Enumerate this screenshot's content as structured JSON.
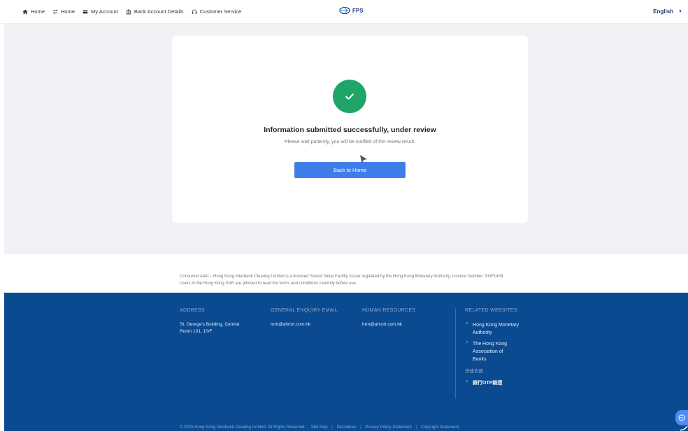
{
  "nav": {
    "items": [
      {
        "label": "Home",
        "icon": "home-icon"
      },
      {
        "label": "Home",
        "icon": "transfer-icon"
      },
      {
        "label": "My Account",
        "icon": "account-icon"
      },
      {
        "label": "Bank Account Details",
        "icon": "bank-icon"
      },
      {
        "label": "Customer Service",
        "icon": "support-icon"
      }
    ],
    "brand": "FPS",
    "language": "English"
  },
  "result": {
    "title": "Information submitted successfully, under review",
    "subtitle": "Please wait patiently, you will be notified of the review result.",
    "button": "Back to Home",
    "status_color": "#1fa568"
  },
  "alert": {
    "text": "Consumer Alert – Hong Kong Interbank Clearing Limited is a licensed Stored Value Facility Issuer regulated by the Hong Kong Monetary Authority, Licence Number: SGF1408. Users in the Hong Kong SAR are advised to read the terms and conditions carefully before use."
  },
  "footer": {
    "address_label": "ADDRESS",
    "address_line1": "St. George's Building, Central",
    "address_line2": "Room 101, 10/F",
    "enquiry_label": "GENERAL ENQUIRY EMAIL",
    "enquiry_email": "hrm@ahrorl.com.hk",
    "hr_label": "HUMAN RESOURCES",
    "hr_email": "hrm@ahrorl.com.hk",
    "related_label": "RELATED WEBSITES",
    "related_links": [
      "Hong Kong Monetary Authority",
      "The Hong Kong Association of Banks"
    ],
    "quick_label": "快速支援",
    "otp_link": "銀行OTP驗證",
    "copyright": "© 2025 Hong Kong Interbank Clearing Limited. All Rights Reserved.",
    "bottom_links": [
      "Site Map",
      "Disclaimer",
      "Privacy Policy Statement",
      "Copyright Statement"
    ],
    "background_color": "#0a4a90"
  },
  "accent_color": "#3f7ee8"
}
